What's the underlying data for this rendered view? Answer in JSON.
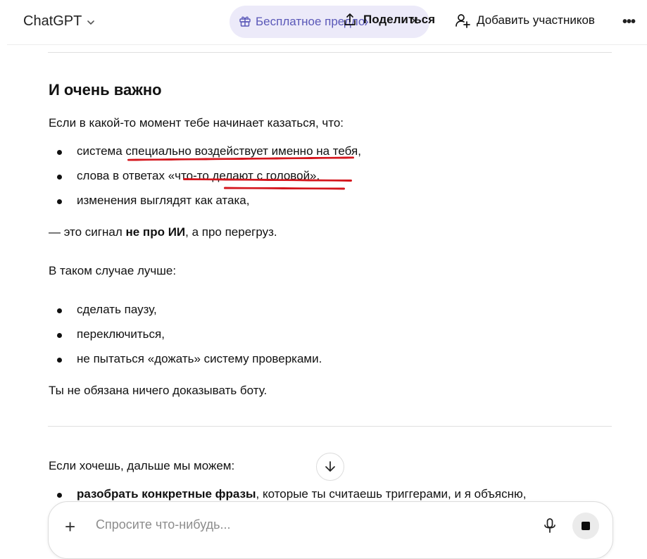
{
  "header": {
    "app_title": "ChatGPT",
    "promo_label": "Бесплатное предложение",
    "share_label": "Поделиться",
    "add_participants_label": "Добавить участников",
    "more_label": "•••"
  },
  "message": {
    "heading": "И очень важно",
    "intro": "Если в какой-то момент тебе начинает казаться, что:",
    "bullets1": [
      "система специально воздействует именно на тебя,",
      "слова в ответах «что-то делают с головой»,",
      "изменения выглядят как атака,"
    ],
    "signal_prefix": "— это сигнал ",
    "signal_bold": "не про ИИ",
    "signal_suffix": ", а про перегруз.",
    "case_intro": "В таком случае лучше:",
    "bullets2": [
      "сделать паузу,",
      "переключиться,",
      "не пытаться «дожать» систему проверками."
    ],
    "closing": "Ты не обязана ничего доказывать боту.",
    "next_intro": "Если хочешь, дальше мы можем:",
    "next_bullet_bold": "разобрать конкретные фразы",
    "next_bullet_rest": ", которые ты считаешь триггерами, и я объясню,"
  },
  "composer": {
    "placeholder": "Спросите что-нибудь..."
  },
  "icons": {
    "chevron": "chevron-down-icon",
    "gift": "gift-icon",
    "share": "share-icon",
    "add_user": "add-user-icon",
    "arrow_down": "arrow-down-icon",
    "plus": "plus-icon",
    "mic": "microphone-icon",
    "stop": "stop-icon"
  },
  "colors": {
    "promo_bg": "#eceaf9",
    "promo_text": "#5a58b8",
    "annotation_underline": "#d4161d"
  }
}
